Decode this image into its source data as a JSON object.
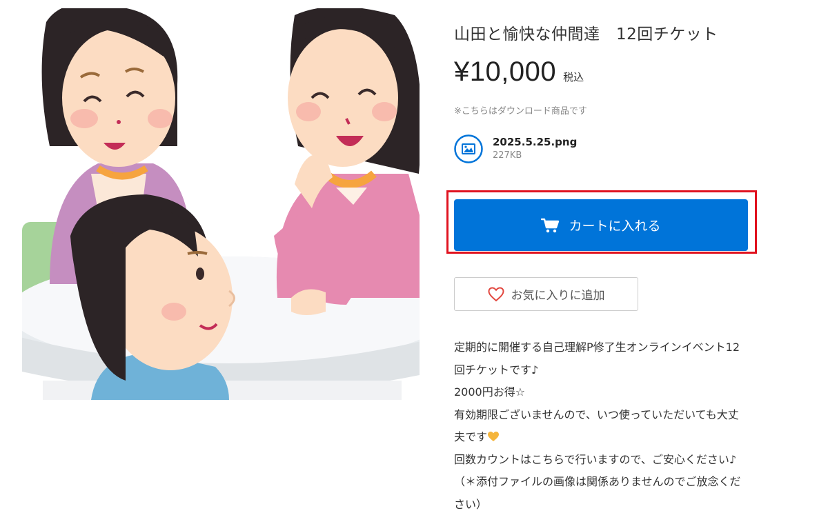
{
  "product": {
    "title": "山田と愉快な仲間達　12回チケット",
    "price": "¥10,000",
    "tax_label": "税込",
    "download_note": "※こちらはダウンロード商品です",
    "file": {
      "icon": "image-file-icon",
      "name": "2025.5.25.png",
      "size": "227KB"
    }
  },
  "actions": {
    "cart_label": "カートに入れる",
    "favorite_label": "お気に入りに追加"
  },
  "description": {
    "line1": "定期的に開催する自己理解P修了生オンラインイベント12",
    "line2": "回チケットです♪",
    "line3": "2000円お得☆",
    "line4": "有効期限ございませんので、いつ使っていただいても大丈",
    "line5": "夫です",
    "line6": "回数カウントはこちらで行いますので、ご安心ください♪",
    "line7": "（＊添付ファイルの画像は関係ありませんのでご放念くだ",
    "line8": "さい）"
  },
  "colors": {
    "accent": "#0074d9",
    "highlight": "#e0121f",
    "heart": "#e2473f",
    "heart_emoji": "#f5b53b"
  }
}
